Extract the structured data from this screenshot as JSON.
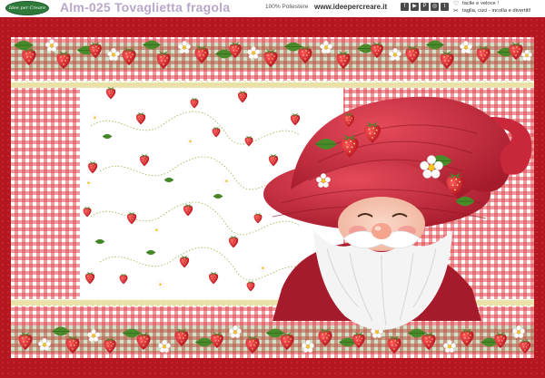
{
  "header": {
    "logo_text": "Idee per Creare",
    "product_title": "Alm-025 Tovaglietta fragola",
    "material": "100% Poliestere",
    "website": "www.ideepercreare.it",
    "social_icons": [
      "facebook-icon",
      "youtube-icon",
      "pinterest-icon",
      "instagram-icon",
      "twitter-icon"
    ],
    "social_glyphs": [
      "f",
      "▶",
      "P",
      "◎",
      "t"
    ],
    "tips": [
      {
        "icon": "heart-icon",
        "glyph": "♡",
        "text": "facile e veloce !"
      },
      {
        "icon": "scissors-icon",
        "glyph": "✂",
        "text": "taglia, cuci - incolla e divertiti!"
      }
    ]
  },
  "colors": {
    "border_red": "#b5161f",
    "border_dot": "#d84b50",
    "gingham_red": "#d8242d",
    "gingham_white": "#ffffff",
    "lace_cream": "#e9e1a6",
    "strawberry": "#d6202a",
    "leaf": "#4a8a2b",
    "hat_red": "#c8283a",
    "beard_white": "#f4f4f4",
    "face_pink": "#f3c5b2"
  }
}
